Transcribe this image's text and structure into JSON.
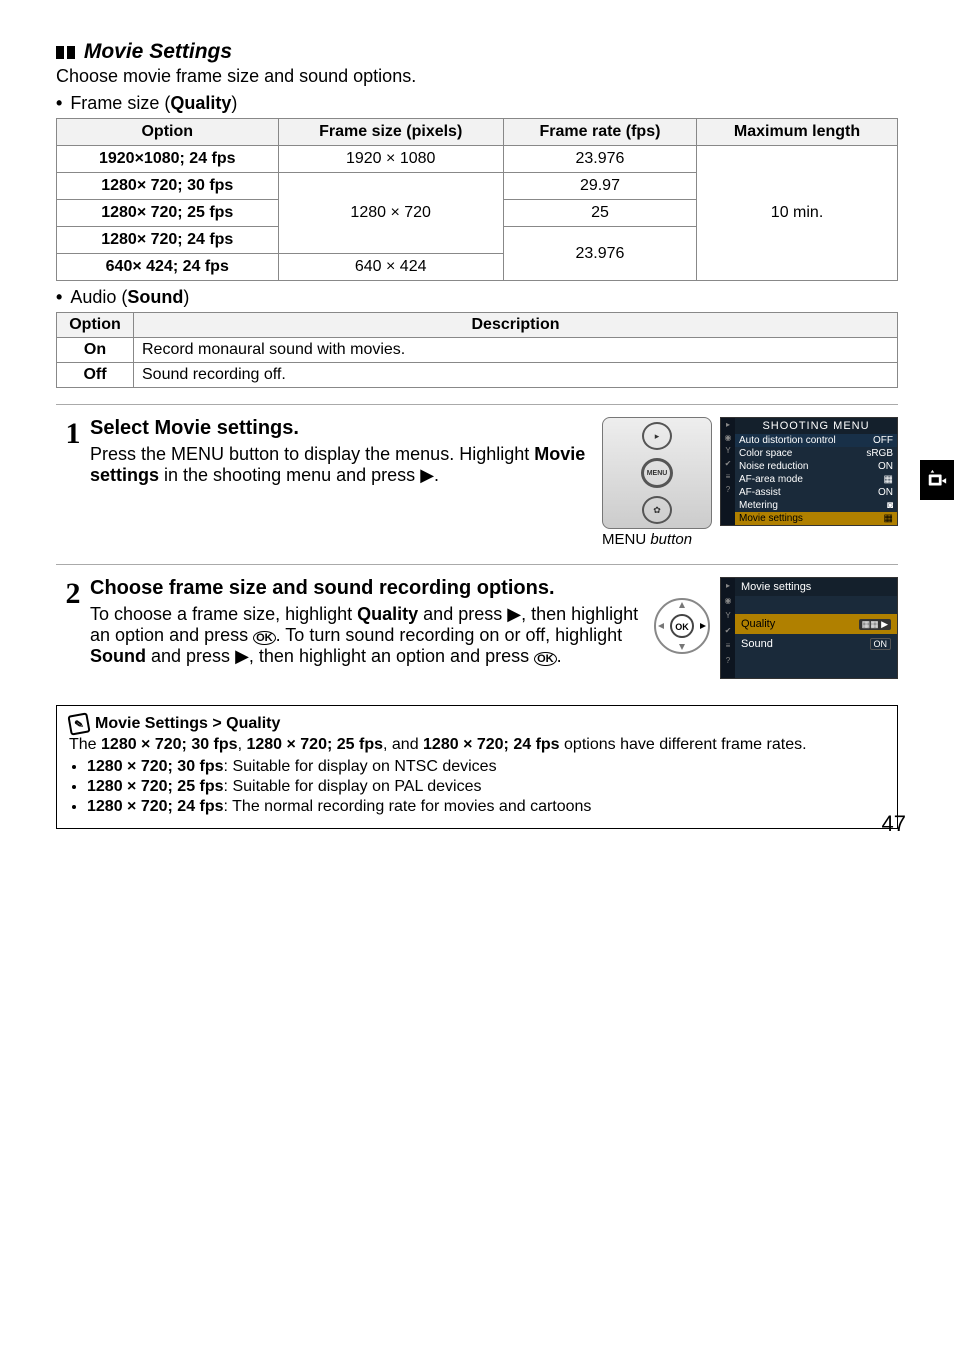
{
  "section": {
    "title": "Movie Settings",
    "intro": "Choose movie frame size and sound options."
  },
  "frame": {
    "bullet_prefix": "Frame size (",
    "bullet_bold": "Quality",
    "bullet_suffix": ")",
    "headers": {
      "option": "Option",
      "size": "Frame size (pixels)",
      "rate": "Frame rate (fps)",
      "max": "Maximum length"
    },
    "rows": [
      {
        "option": "1920×1080; 24 fps",
        "size": "1920 × 1080",
        "rate": "23.976"
      },
      {
        "option": "1280×  720; 30 fps",
        "size": "1280 × 720",
        "rate": "29.97"
      },
      {
        "option": "1280×  720; 25 fps",
        "size": "",
        "rate": "25"
      },
      {
        "option": "1280×  720; 24 fps",
        "size": "",
        "rate": "23.976"
      },
      {
        "option": "  640×  424; 24 fps",
        "size": "640 × 424",
        "rate": ""
      }
    ],
    "max": "10 min."
  },
  "audio": {
    "bullet_prefix": "Audio (",
    "bullet_bold": "Sound",
    "bullet_suffix": ")",
    "headers": {
      "option": "Option",
      "desc": "Description"
    },
    "rows": [
      {
        "option": "On",
        "desc": "Record monaural sound with movies."
      },
      {
        "option": "Off",
        "desc": "Sound recording off."
      }
    ]
  },
  "steps": {
    "s1": {
      "num": "1",
      "title": "Select Movie settings.",
      "body_a": "Press the ",
      "body_menu": "MENU",
      "body_b": " button to display the menus. Highlight ",
      "body_bold": "Movie settings",
      "body_c": " in the shooting menu and press ",
      "arrow": "▶",
      "body_d": ".",
      "caption_menu": "MENU",
      "caption_suffix": " button"
    },
    "s2": {
      "num": "2",
      "title": "Choose frame size and sound recording options.",
      "body_a": "To choose a frame size, highlight ",
      "body_bold1": "Quality",
      "body_b": " and press ",
      "arrow1": "▶",
      "body_c": ", then highlight an option and press ",
      "ok1": "OK",
      "body_d": ".  To turn sound recording on or off, highlight ",
      "body_bold2": "Sound",
      "body_e": " and press ",
      "arrow2": "▶",
      "body_f": ", then highlight an option and press ",
      "ok2": "OK",
      "body_g": "."
    }
  },
  "note": {
    "title": "Movie Settings > Quality",
    "intro_a": "The ",
    "b1": "1280 × 720; 30 fps",
    "comma1": ", ",
    "b2": "1280 × 720; 25 fps",
    "comma2": ", and ",
    "b3": "1280 × 720; 24 fps",
    "intro_b": " options have different frame rates.",
    "li1_b": "1280 × 720; 30 fps",
    "li1_t": ": Suitable for display on NTSC devices",
    "li2_b": "1280 × 720; 25 fps",
    "li2_t": ": Suitable for display on PAL devices",
    "li3_b": "1280 × 720; 24 fps",
    "li3_t": ": The normal recording rate for movies and cartoons"
  },
  "menu_screen": {
    "header": "SHOOTING MENU",
    "items": [
      {
        "label": "Auto distortion control",
        "val": "OFF"
      },
      {
        "label": "Color space",
        "val": "sRGB"
      },
      {
        "label": "Noise reduction",
        "val": "ON"
      },
      {
        "label": "AF-area mode",
        "val": "▦"
      },
      {
        "label": "AF-assist",
        "val": "ON"
      },
      {
        "label": "Metering",
        "val": "◙"
      },
      {
        "label": "Movie settings",
        "val": "▦"
      }
    ]
  },
  "sub_screen": {
    "header": "Movie settings",
    "quality_label": "Quality",
    "quality_val": "▦▦ ▶",
    "sound_label": "Sound",
    "sound_val": "ON"
  },
  "page_num": "47"
}
